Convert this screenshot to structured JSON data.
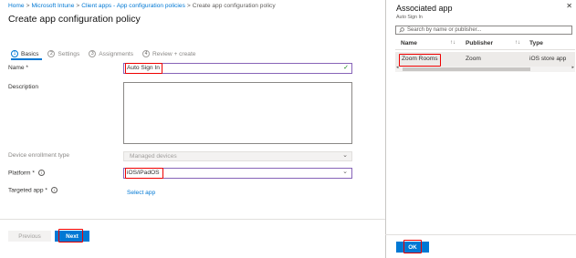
{
  "breadcrumb": {
    "items": [
      "Home",
      "Microsoft Intune",
      "Client apps - App configuration policies",
      "Create app configuration policy"
    ],
    "separator": ">"
  },
  "page_title": "Create app configuration policy",
  "steps": [
    {
      "num": "1",
      "label": "Basics"
    },
    {
      "num": "2",
      "label": "Settings"
    },
    {
      "num": "3",
      "label": "Assignments"
    },
    {
      "num": "4",
      "label": "Review + create"
    }
  ],
  "form": {
    "name_label": "Name *",
    "name_value": "Auto Sign In",
    "description_label": "Description",
    "description_value": "",
    "device_enrollment_label": "Device enrollment type",
    "device_enrollment_value": "Managed devices",
    "platform_label": "Platform *",
    "platform_value": "iOS/iPadOS",
    "targeted_app_label": "Targeted app *",
    "select_app_link": "Select app"
  },
  "footer": {
    "previous_label": "Previous",
    "next_label": "Next"
  },
  "panel": {
    "title": "Associated app",
    "subtitle": "Auto Sign In",
    "search_placeholder": "Search by name or publisher...",
    "columns": [
      "Name",
      "Publisher",
      "Type"
    ],
    "rows": [
      {
        "name": "Zoom Rooms",
        "publisher": "Zoom",
        "type": "iOS store app"
      }
    ],
    "ok_label": "OK"
  },
  "colors": {
    "accent": "#0078d4",
    "highlight_box": "#e00000",
    "focus_border": "#8764b8"
  },
  "icons": [
    "info-icon",
    "checkmark-icon",
    "chevron-down-icon",
    "search-icon",
    "sort-icon",
    "close-icon"
  ]
}
